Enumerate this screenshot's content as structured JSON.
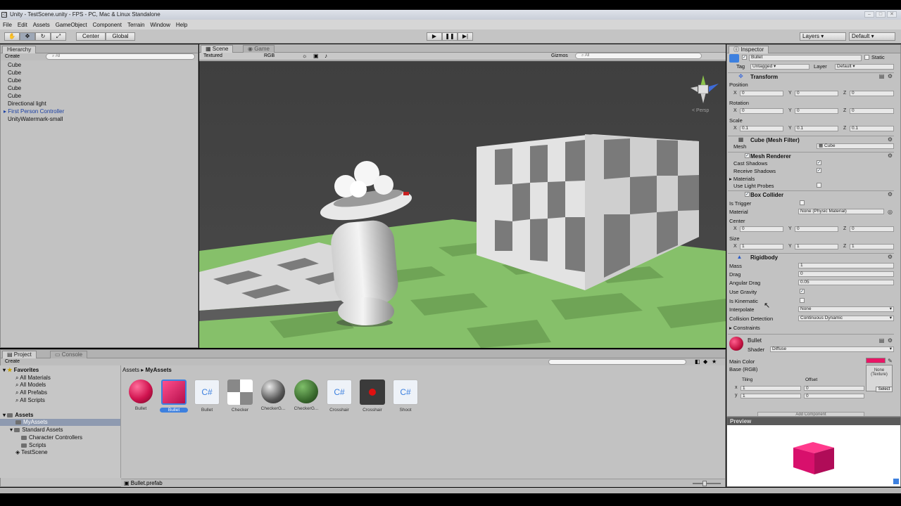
{
  "window": {
    "title": "Unity - TestScene.unity - FPS - PC, Mac & Linux Standalone"
  },
  "menu": [
    "File",
    "Edit",
    "Assets",
    "GameObject",
    "Component",
    "Terrain",
    "Window",
    "Help"
  ],
  "toolbar": {
    "pivot": "Center",
    "space": "Global",
    "layers": "Layers",
    "layout": "Default"
  },
  "hierarchy": {
    "tab": "Hierarchy",
    "create": "Create",
    "items": [
      "Cube",
      "Cube",
      "Cube",
      "Cube",
      "Cube",
      "Directional light",
      "First Person Controller",
      "UnityWatermark-small"
    ]
  },
  "scene": {
    "tab": "Scene",
    "game_tab": "Game",
    "render_mode": "Textured",
    "color_mode": "RGB",
    "gizmos": "Gizmos",
    "persp": "< Persp"
  },
  "inspector": {
    "tab": "Inspector",
    "name": "Bullet",
    "static": "Static",
    "tag_label": "Tag",
    "tag": "Untagged",
    "layer_label": "Layer",
    "layer": "Default",
    "transform": {
      "title": "Transform",
      "position": "Position",
      "rotation": "Rotation",
      "scale": "Scale",
      "pos": [
        "0",
        "0",
        "0"
      ],
      "rot": [
        "0",
        "0",
        "0"
      ],
      "scl": [
        "0.1",
        "0.1",
        "0.1"
      ]
    },
    "mesh_filter": {
      "title": "Cube (Mesh Filter)",
      "mesh_label": "Mesh",
      "mesh": "Cube"
    },
    "mesh_renderer": {
      "title": "Mesh Renderer",
      "cast": "Cast Shadows",
      "receive": "Receive Shadows",
      "materials": "Materials",
      "probes": "Use Light Probes"
    },
    "box_collider": {
      "title": "Box Collider",
      "trigger": "Is Trigger",
      "material_label": "Material",
      "material": "None (Physic Material)",
      "center": "Center",
      "size": "Size",
      "center_v": [
        "0",
        "0",
        "0"
      ],
      "size_v": [
        "1",
        "1",
        "1"
      ]
    },
    "rigidbody": {
      "title": "Rigidbody",
      "mass_label": "Mass",
      "mass": "1",
      "drag_label": "Drag",
      "drag": "0",
      "ang_label": "Angular Drag",
      "ang": "0.05",
      "gravity": "Use Gravity",
      "kinematic": "Is Kinematic",
      "interp_label": "Interpolate",
      "interp": "None",
      "coll_label": "Collision Detection",
      "coll": "Continuous Dynamic",
      "constraints": "Constraints"
    },
    "material": {
      "name": "Bullet",
      "shader_label": "Shader",
      "shader": "Diffuse",
      "main_color": "Main Color",
      "base": "Base (RGB)",
      "tiling": "Tiling",
      "offset": "Offset",
      "none_texture": "None (Texture)",
      "select": "Select",
      "x_t": "1",
      "x_o": "0",
      "y_t": "1",
      "y_o": "0"
    },
    "add_component": "Add Component",
    "preview": "Preview"
  },
  "project": {
    "tab": "Project",
    "console_tab": "Console",
    "create": "Create",
    "favorites": "Favorites",
    "fav_items": [
      "All Materials",
      "All Models",
      "All Prefabs",
      "All Scripts"
    ],
    "assets_root": "Assets",
    "tree": [
      "MyAssets",
      "Standard Assets",
      "Character Controllers",
      "Scripts",
      "TestScene"
    ],
    "breadcrumb_root": "Assets",
    "breadcrumb_leaf": "MyAssets",
    "assets": [
      "Bullet",
      "Bullet",
      "Bullet",
      "Checker",
      "CheckerG...",
      "CheckerG...",
      "Crosshair",
      "Crosshair",
      "Shoot"
    ],
    "status": "Bullet.prefab"
  },
  "colors": {
    "accent": "#d0134f",
    "selection": "#3d80df",
    "ground_green": "#86c06a"
  }
}
